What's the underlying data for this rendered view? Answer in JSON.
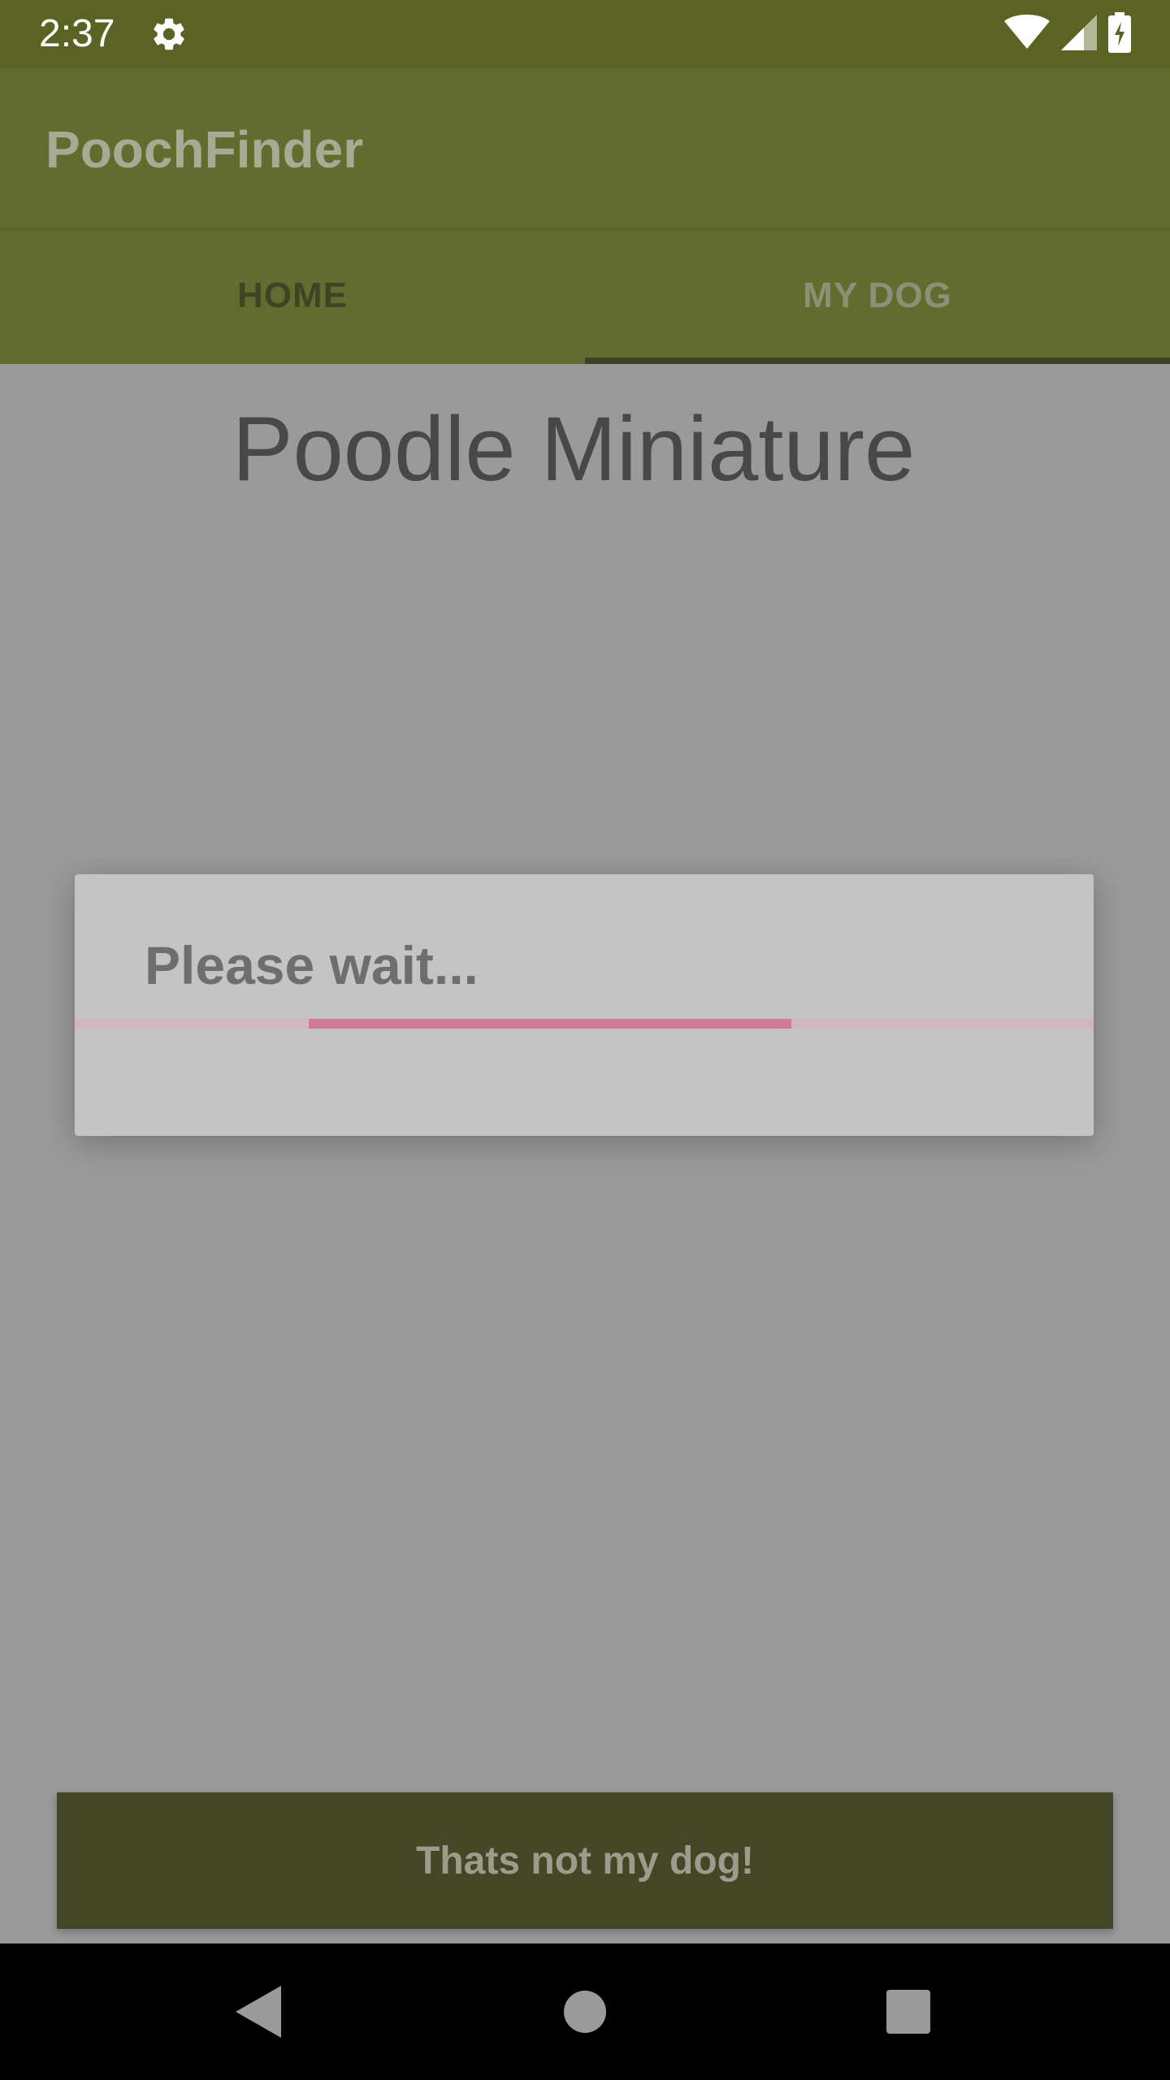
{
  "status_bar": {
    "time": "2:37",
    "icons": [
      "gear-icon",
      "wifi-icon",
      "signal-icon",
      "battery-icon"
    ]
  },
  "app_bar": {
    "title": "PoochFinder"
  },
  "tabs": [
    {
      "label": "HOME",
      "selected": false
    },
    {
      "label": "MY DOG",
      "selected": true
    }
  ],
  "main": {
    "breed_title": "Poodle Miniature"
  },
  "dialog": {
    "message": "Please wait...",
    "progress_fraction": 0.473,
    "progress_start_fraction": 0.23
  },
  "action": {
    "label": "Thats not my dog!"
  },
  "nav_bar": {
    "icons": [
      "back-icon",
      "home-icon",
      "recents-icon"
    ]
  },
  "colors": {
    "status_bar": "#5a6323",
    "app_bar": "#636c2f",
    "scrim_background": "#9a9a9a",
    "progress_accent": "#d07a95",
    "button": "#434726"
  }
}
